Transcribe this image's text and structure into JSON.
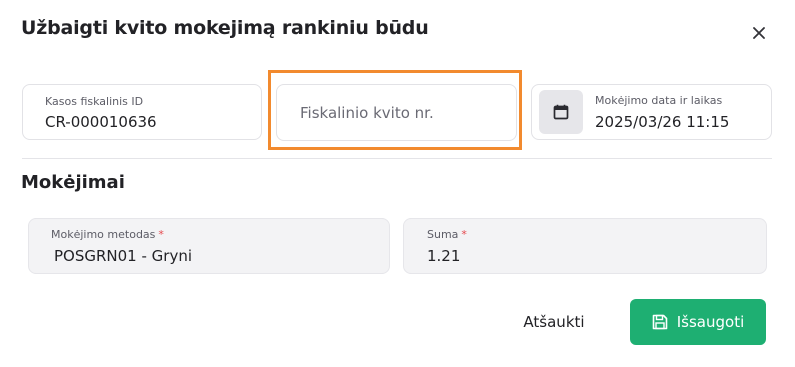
{
  "dialog": {
    "title": "Užbaigti kvito mokejimą rankiniu būdu",
    "close_icon": "close-icon"
  },
  "fields": {
    "kasos": {
      "label": "Kasos fiskalinis ID",
      "value": "CR-000010636"
    },
    "fiskalinis": {
      "placeholder": "Fiskalinio kvito nr.",
      "value": "",
      "focus_color": "#f28a2e"
    },
    "data": {
      "label": "Mokėjimo data ir laikas",
      "value": "2025/03/26 11:15",
      "icon": "calendar-icon"
    }
  },
  "payments": {
    "section_title": "Mokėjimai",
    "method": {
      "label": "Mokėjimo metodas",
      "required_mark": "*",
      "value": "POSGRN01 - Gryni"
    },
    "amount": {
      "label": "Suma",
      "required_mark": "*",
      "value": "1.21"
    }
  },
  "actions": {
    "cancel_label": "Atšaukti",
    "save_label": "Išsaugoti",
    "save_icon": "save-icon",
    "save_color": "#1eaf72"
  }
}
